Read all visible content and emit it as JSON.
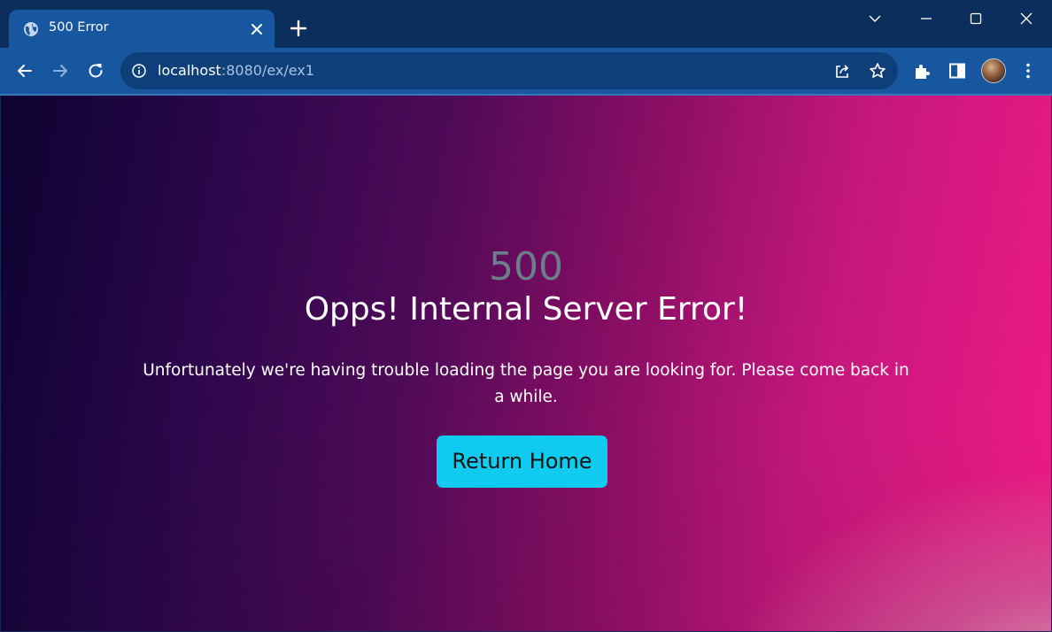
{
  "browser": {
    "tab": {
      "title": "500 Error",
      "favicon": "globe-icon",
      "close_icon": "close-icon"
    },
    "new_tab_icon": "plus-icon",
    "window_controls": [
      "chevron-down-icon",
      "minimize-icon",
      "maximize-icon",
      "close-icon"
    ],
    "nav": {
      "back": "back-arrow-icon",
      "forward": "forward-arrow-icon",
      "reload": "reload-icon"
    },
    "address_bar": {
      "host": "localhost",
      "path": ":8080/ex/ex1",
      "info_icon": "info-icon"
    },
    "omnibox_actions": [
      "share-icon",
      "star-icon"
    ],
    "toolbar_actions": [
      "extensions-icon",
      "side-panel-icon",
      "avatar",
      "more-menu-icon"
    ],
    "colors": {
      "tab_strip": "#0c2e5c",
      "toolbar": "#1657a0",
      "omnibox": "#0f3f78"
    }
  },
  "page": {
    "error_code": "500",
    "headline": "Opps! Internal Server Error!",
    "message": "Unfortunately we're having trouble loading the page you are looking for. Please come back in a while.",
    "button_label": "Return Home",
    "colors": {
      "button": "#0fcbf0",
      "code_text": "#6b7f8a",
      "gradient_start": "#0d0330",
      "gradient_end": "#f11a86"
    }
  }
}
